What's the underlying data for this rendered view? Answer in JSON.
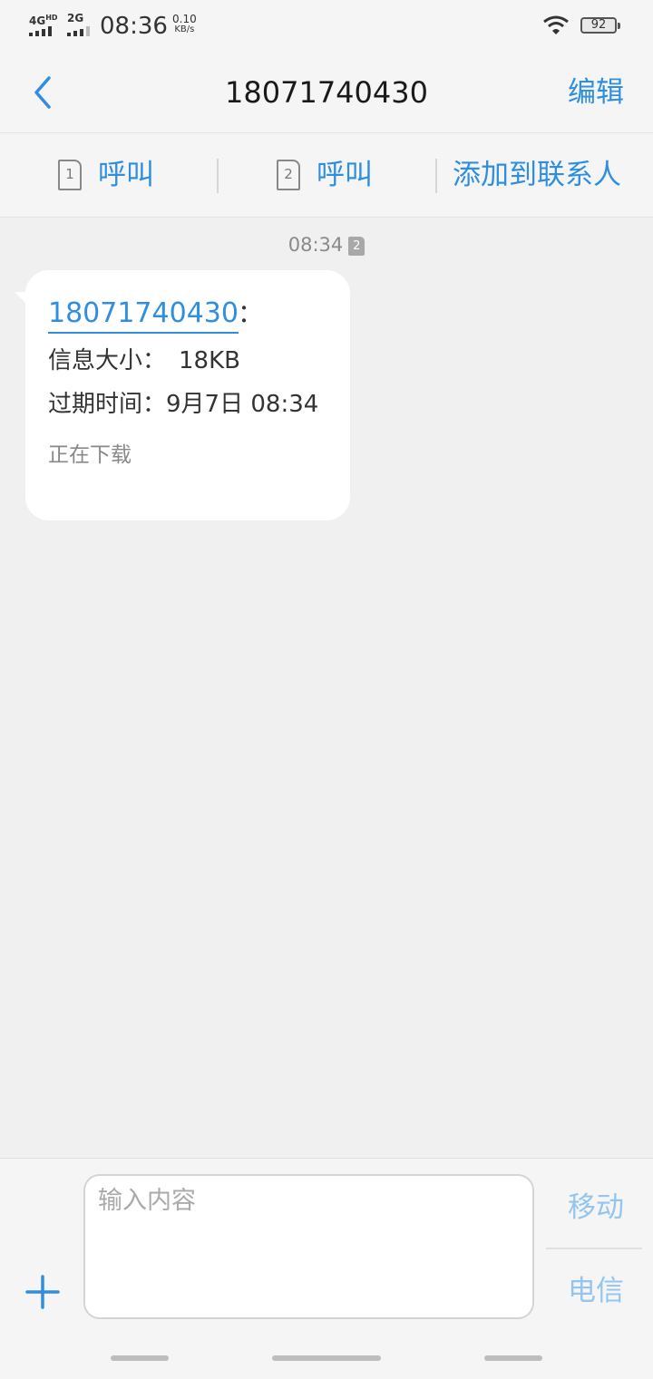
{
  "status_bar": {
    "network1": "4G",
    "network1_sup": "HD",
    "network2": "2G",
    "time": "08:36",
    "net_speed_value": "0.10",
    "net_speed_unit": "KB/s",
    "battery": "92"
  },
  "header": {
    "title": "18071740430",
    "edit_label": "编辑"
  },
  "actions": {
    "call_sim1_icon": "1",
    "call_sim1_label": "呼叫",
    "call_sim2_icon": "2",
    "call_sim2_label": "呼叫",
    "add_contact_label": "添加到联系人"
  },
  "message": {
    "time": "08:34",
    "sim_badge": "2",
    "sender": "18071740430",
    "colon": "：",
    "size_label": "信息大小：",
    "size_value": "18KB",
    "expire_label": "过期时间：",
    "expire_value": "9月7日 08:34",
    "status": "正在下载"
  },
  "composer": {
    "placeholder": "输入内容",
    "send_sim1": "移动",
    "send_sim2": "电信"
  },
  "colors": {
    "accent": "#2f8ee0",
    "accent_disabled": "#93c5ee",
    "background": "#f0f0f0"
  }
}
